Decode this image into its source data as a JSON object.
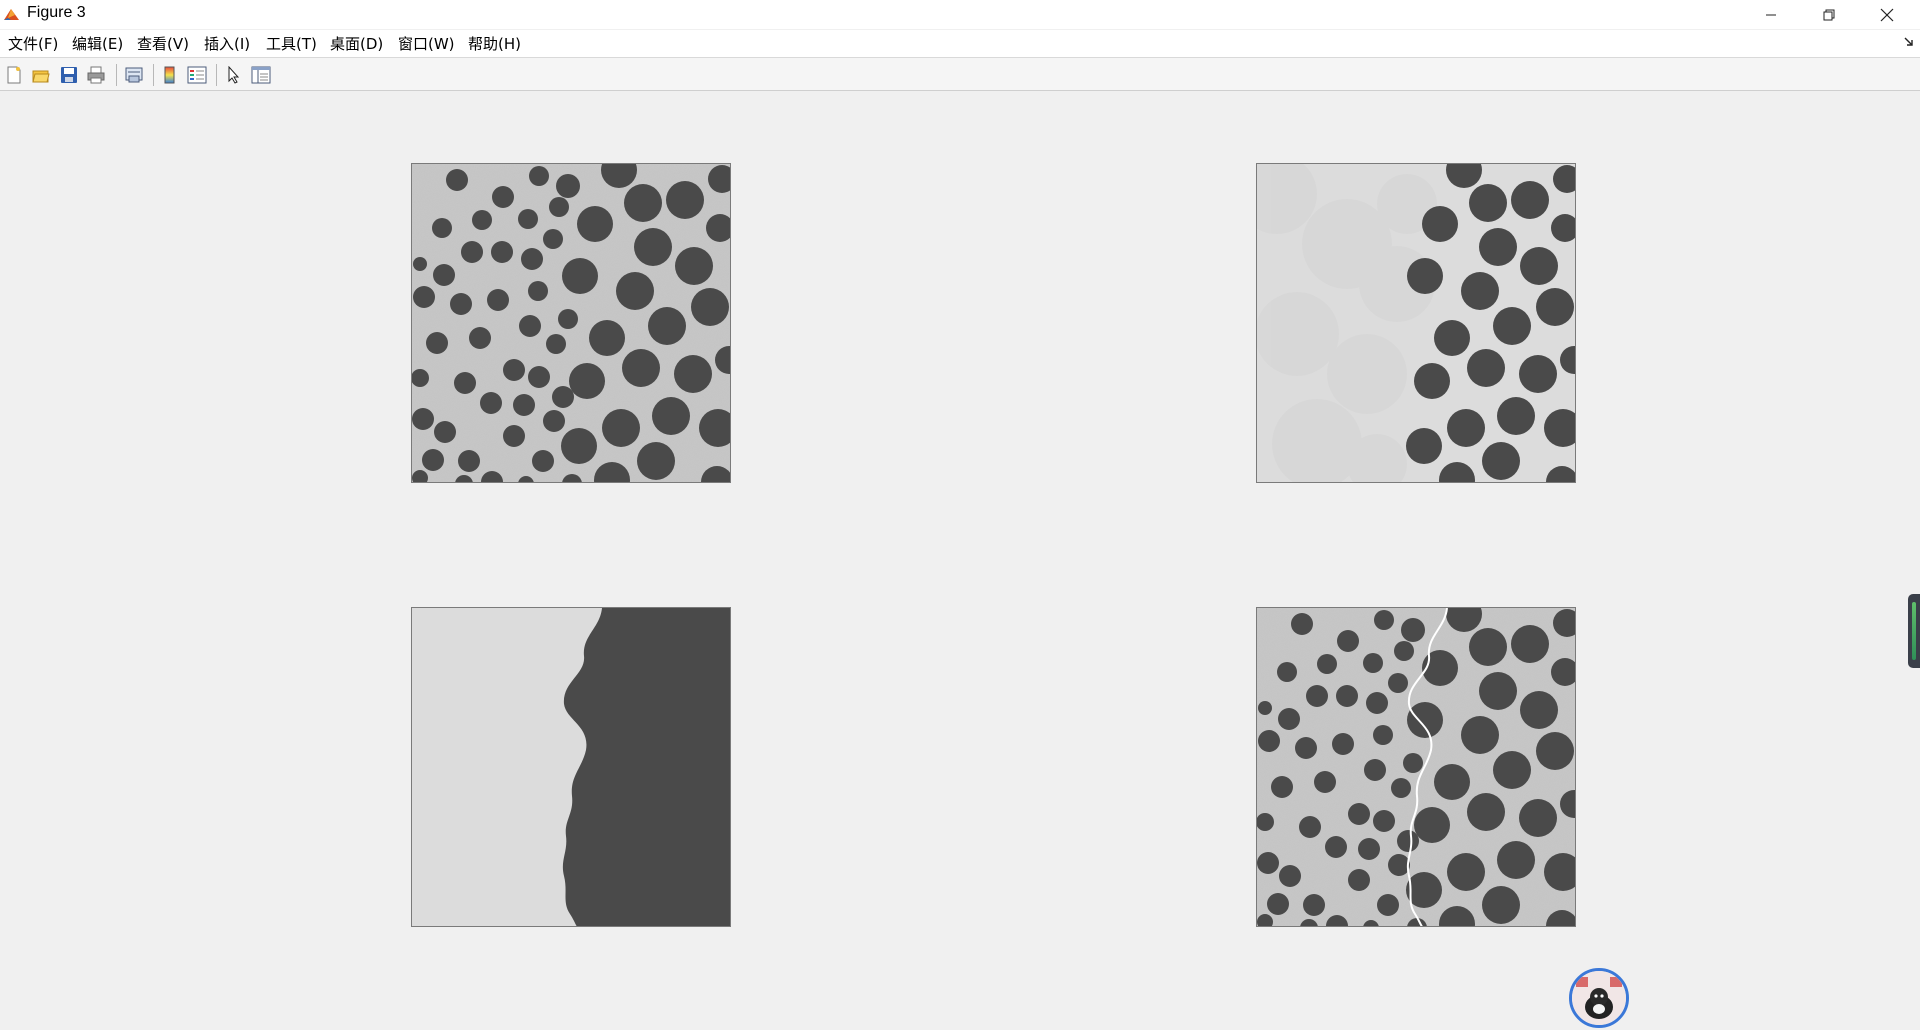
{
  "window": {
    "title": "Figure 3",
    "icon": "matlab-icon"
  },
  "menu": [
    {
      "label": "文件(F)"
    },
    {
      "label": "编辑(E)"
    },
    {
      "label": "查看(V)"
    },
    {
      "label": "插入(I)"
    },
    {
      "label": "工具(T)"
    },
    {
      "label": "桌面(D)"
    },
    {
      "label": "窗口(W)"
    },
    {
      "label": "帮助(H)"
    }
  ],
  "toolbar": [
    {
      "icon": "new-figure-icon"
    },
    {
      "icon": "open-file-icon"
    },
    {
      "icon": "save-icon"
    },
    {
      "icon": "print-icon"
    },
    {
      "icon": "link-plot-icon"
    },
    {
      "icon": "insert-colorbar-icon"
    },
    {
      "icon": "insert-legend-icon"
    },
    {
      "icon": "edit-plot-arrow-icon"
    },
    {
      "icon": "property-inspector-icon"
    }
  ],
  "subplots": [
    {
      "content": "noisy image of dark circles on grey textured background"
    },
    {
      "content": "segmented image: right half with circles, left flat light grey"
    },
    {
      "content": "two-region mask: light grey left, dark grey right, wavy boundary"
    },
    {
      "content": "original image with white wavy contour overlay"
    }
  ],
  "colors": {
    "background": "#f0f0f0",
    "circle": "#4a4a4a",
    "texture": "#c9c9c9",
    "contour": "#ffffff"
  }
}
